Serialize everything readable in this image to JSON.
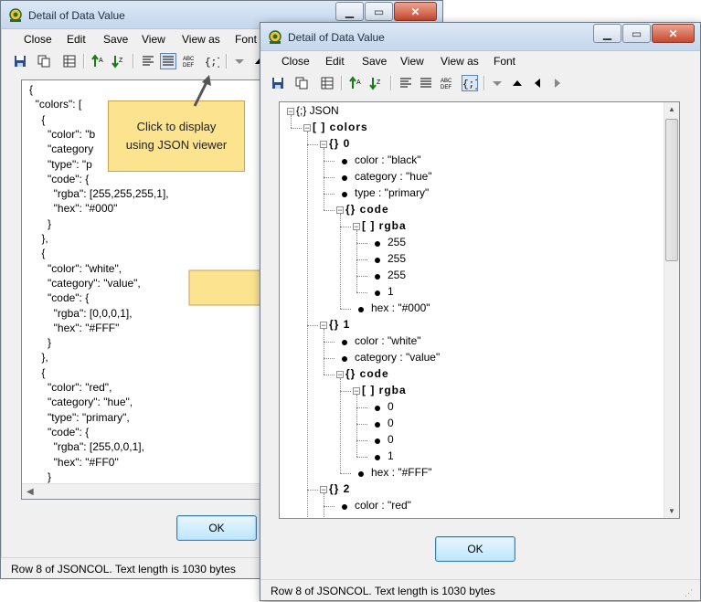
{
  "background_window": {
    "title": "Detail of Data Value",
    "menu": [
      "Close",
      "Edit",
      "Save",
      "View",
      "View as",
      "Font"
    ],
    "text_lines": [
      "{",
      "  \"colors\": [",
      "    {",
      "      \"color\": \"b",
      "      \"category",
      "      \"type\": \"p",
      "      \"code\": {",
      "        \"rgba\": [255,255,255,1],",
      "        \"hex\": \"#000\"",
      "      }",
      "    },",
      "    {",
      "      \"color\": \"white\",",
      "      \"category\": \"value\",",
      "      \"code\": {",
      "        \"rgba\": [0,0,0,1],",
      "        \"hex\": \"#FFF\"",
      "      }",
      "    },",
      "    {",
      "      \"color\": \"red\",",
      "      \"category\": \"hue\",",
      "      \"type\": \"primary\",",
      "      \"code\": {",
      "        \"rgba\": [255,0,0,1],",
      "        \"hex\": \"#FF0\"",
      "      }"
    ],
    "ok_label": "OK",
    "status": "Row 8 of JSONCOL. Text length is 1030 bytes"
  },
  "foreground_window": {
    "title": "Detail of Data Value",
    "menu": [
      "Close",
      "Edit",
      "Save",
      "View",
      "View as",
      "Font"
    ],
    "tree": [
      {
        "text": "{;} JSON",
        "depth": 0,
        "kind": "root"
      },
      {
        "text": "[ ] colors",
        "depth": 1,
        "kind": "array"
      },
      {
        "text": "{} 0",
        "depth": 2,
        "kind": "object"
      },
      {
        "text": "color : \"black\"",
        "depth": 3,
        "kind": "leaf"
      },
      {
        "text": "category : \"hue\"",
        "depth": 3,
        "kind": "leaf"
      },
      {
        "text": "type : \"primary\"",
        "depth": 3,
        "kind": "leaf"
      },
      {
        "text": "{} code",
        "depth": 3,
        "kind": "object"
      },
      {
        "text": "[ ] rgba",
        "depth": 4,
        "kind": "array"
      },
      {
        "text": "255",
        "depth": 5,
        "kind": "leaf"
      },
      {
        "text": "255",
        "depth": 5,
        "kind": "leaf"
      },
      {
        "text": "255",
        "depth": 5,
        "kind": "leaf"
      },
      {
        "text": "1",
        "depth": 5,
        "kind": "leaf"
      },
      {
        "text": "hex : \"#000\"",
        "depth": 4,
        "kind": "leaf"
      },
      {
        "text": "{} 1",
        "depth": 2,
        "kind": "object"
      },
      {
        "text": "color : \"white\"",
        "depth": 3,
        "kind": "leaf"
      },
      {
        "text": "category : \"value\"",
        "depth": 3,
        "kind": "leaf"
      },
      {
        "text": "{} code",
        "depth": 3,
        "kind": "object"
      },
      {
        "text": "[ ] rgba",
        "depth": 4,
        "kind": "array"
      },
      {
        "text": "0",
        "depth": 5,
        "kind": "leaf"
      },
      {
        "text": "0",
        "depth": 5,
        "kind": "leaf"
      },
      {
        "text": "0",
        "depth": 5,
        "kind": "leaf"
      },
      {
        "text": "1",
        "depth": 5,
        "kind": "leaf"
      },
      {
        "text": "hex : \"#FFF\"",
        "depth": 4,
        "kind": "leaf"
      },
      {
        "text": "{} 2",
        "depth": 2,
        "kind": "object"
      },
      {
        "text": "color : \"red\"",
        "depth": 3,
        "kind": "leaf"
      }
    ],
    "ok_label": "OK",
    "status": "Row 8 of JSONCOL. Text length is 1030 bytes"
  },
  "callout": {
    "line1": "Click to display",
    "line2": "using JSON viewer"
  },
  "colors": {
    "callout_fill": "#fbe38f",
    "arrow_fill": "#fbe38f",
    "title_bar": "#c5d7ec",
    "close_button": "#c7492f"
  }
}
